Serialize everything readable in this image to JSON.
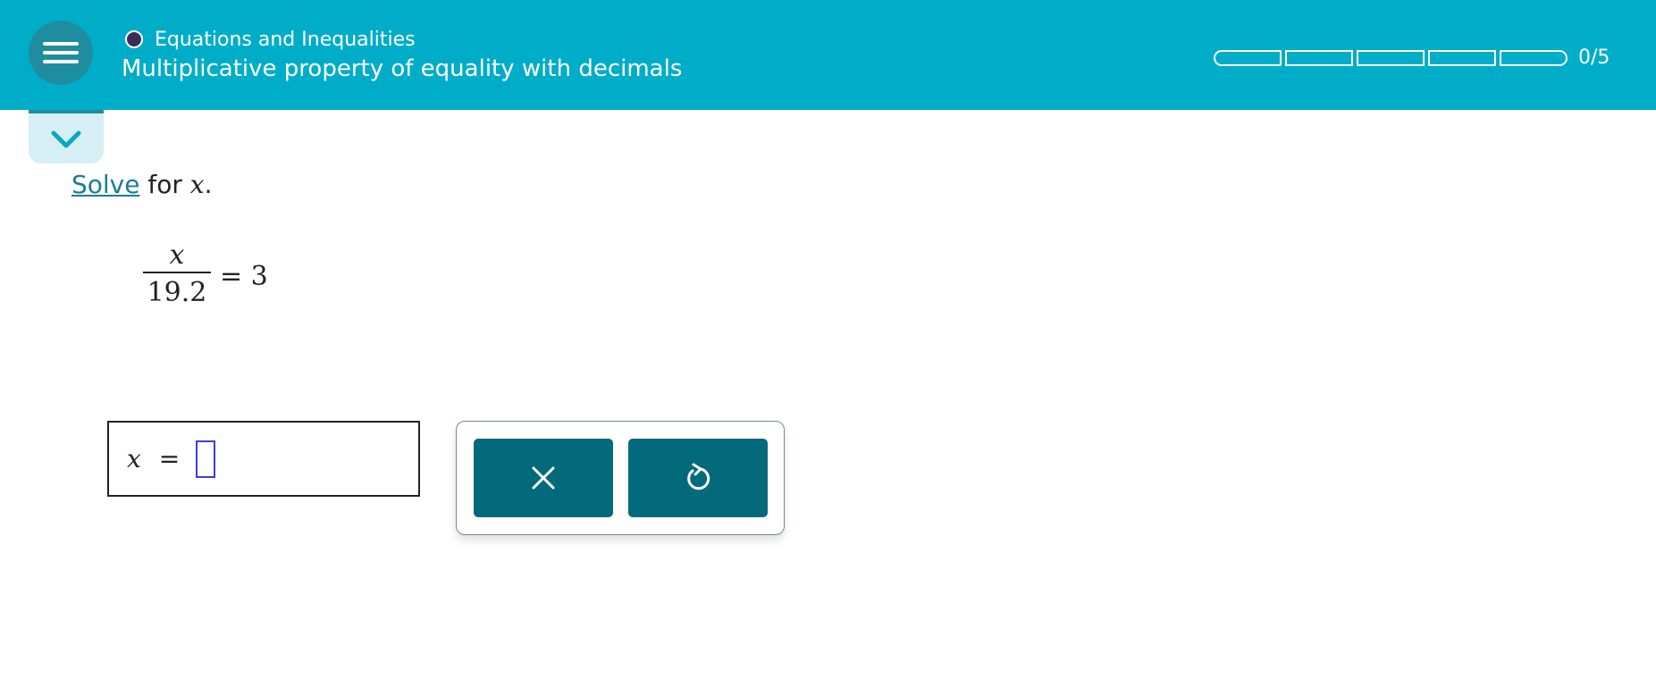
{
  "header": {
    "topic": "Equations and Inequalities",
    "title": "Multiplicative property of equality with decimals",
    "progress_text": "0/5",
    "progress_fraction": 0,
    "colors": {
      "background": "#00adc9",
      "menu": "#1f8da0",
      "dot": "#3c2b57"
    }
  },
  "icons": {
    "menu": "menu-icon",
    "collapse": "chevron-down-icon",
    "clear": "close-icon",
    "undo": "undo-icon"
  },
  "question": {
    "prompt_link": "Solve",
    "prompt_rest": " for ",
    "prompt_var": "x",
    "prompt_end": ".",
    "numerator": "x",
    "denominator": "19.2",
    "rhs": "= 3"
  },
  "answer": {
    "var": "x",
    "equals": "=",
    "value": ""
  },
  "colors": {
    "tool_button": "#036a7c",
    "link": "#1b7d93",
    "cursor": "#3b3bf0"
  }
}
